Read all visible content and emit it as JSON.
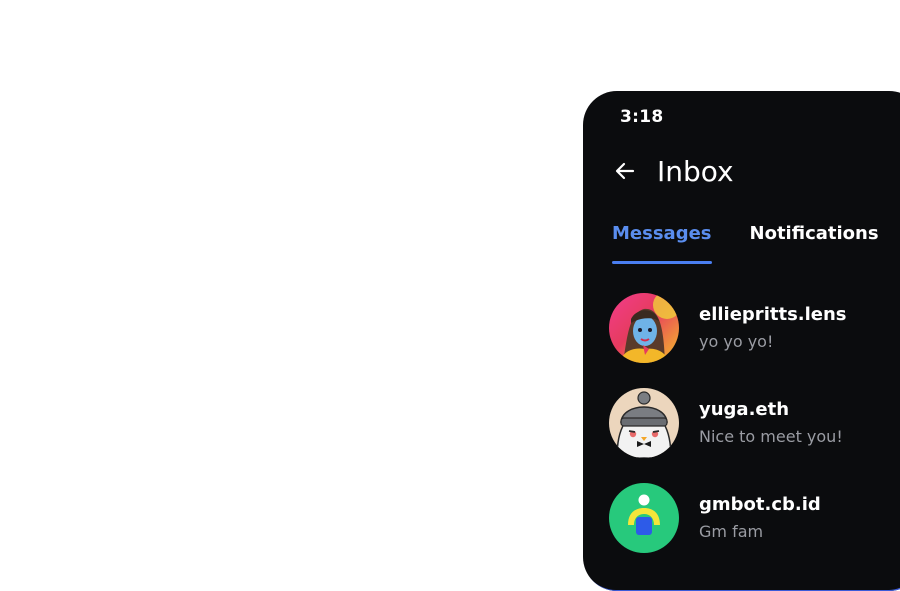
{
  "status": {
    "time": "3:18"
  },
  "header": {
    "title": "Inbox",
    "back_icon": "arrow-left-icon"
  },
  "tabs": [
    {
      "label": "Messages",
      "active": true
    },
    {
      "label": "Notifications",
      "active": false
    }
  ],
  "colors": {
    "background": "#0b0c0e",
    "accent": "#5a8dee",
    "muted_text": "#9a9ca3"
  },
  "conversations": [
    {
      "name": "elliepritts.lens",
      "preview": "yo yo yo!"
    },
    {
      "name": "yuga.eth",
      "preview": "Nice to meet you!"
    },
    {
      "name": "gmbot.cb.id",
      "preview": "Gm fam"
    }
  ]
}
